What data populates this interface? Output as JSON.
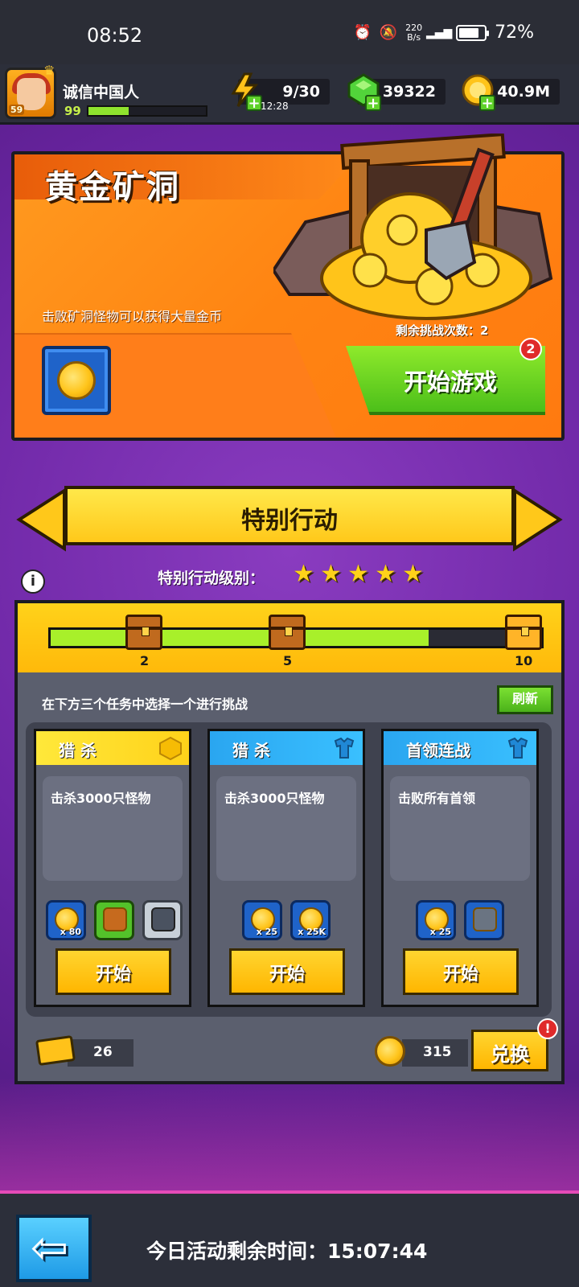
{
  "status_bar": {
    "time": "08:52",
    "net_speed_value": "220",
    "net_speed_unit": "B/s",
    "battery": "72%"
  },
  "player": {
    "name": "诚信中国人",
    "avatar_badge": "59",
    "level": "99"
  },
  "resources": {
    "energy": "9/30",
    "energy_timer": "12:28",
    "gems": "39322",
    "gold": "40.9M"
  },
  "gold_mine": {
    "title": "黄金矿洞",
    "description": "击败矿洞怪物可以获得大量金币",
    "remaining_label": "剩余挑战次数：2",
    "start_label": "开始游戏",
    "badge_count": "2"
  },
  "special_action": {
    "title": "特别行动",
    "level_label": "特别行动级别：",
    "stars": 5,
    "progress": {
      "fraction": 0.77,
      "milestones": [
        "2",
        "5",
        "10"
      ]
    },
    "instruction": "在下方三个任务中选择一个进行挑战",
    "refresh_label": "刷新"
  },
  "tasks": [
    {
      "title": "猎 杀",
      "description": "击杀3000只怪物",
      "start_label": "开始",
      "color": "#ffe83a",
      "rewards": [
        "x 80",
        "",
        ""
      ]
    },
    {
      "title": "猎 杀",
      "description": "击杀3000只怪物",
      "start_label": "开始",
      "color": "#2aa6f0",
      "rewards": [
        "x 25",
        "x 25K"
      ]
    },
    {
      "title": "首领连战",
      "description": "击败所有首领",
      "start_label": "开始",
      "color": "#2aa6f0",
      "rewards": [
        "x 25",
        ""
      ]
    }
  ],
  "footer": {
    "tickets": "26",
    "coins": "315",
    "exchange_label": "兑换",
    "alert": "!"
  },
  "bottom_bar": {
    "timer_text": "今日活动剩余时间：15:07:44"
  },
  "colors": {
    "accent_orange": "#ff8412",
    "accent_green": "#4cbf1a",
    "accent_yellow": "#ffc81a",
    "bg_purple": "#6b25a3"
  }
}
